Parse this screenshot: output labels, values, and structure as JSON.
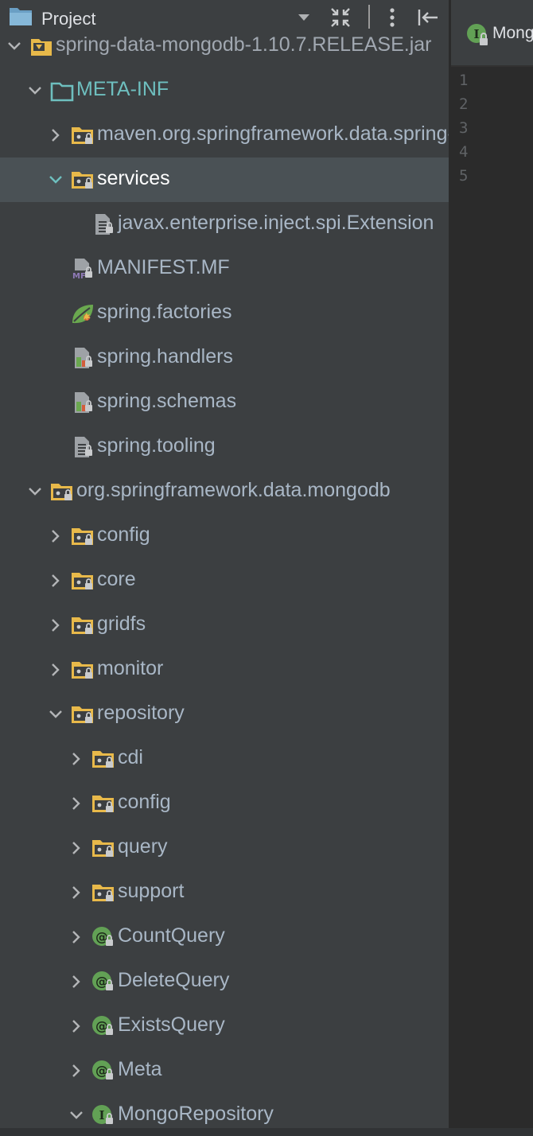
{
  "panel": {
    "title": "Project"
  },
  "tree": [
    {
      "label": "spring-data-mongodb-1.10.7.RELEASE.jar",
      "depth": 0,
      "expanded": true,
      "icon": "jar-icon",
      "style": "muted"
    },
    {
      "label": "META-INF",
      "depth": 1,
      "expanded": true,
      "icon": "meta-folder-icon",
      "style": "meta"
    },
    {
      "label": "maven.org.springframework.data.spring-data-mongodb",
      "depth": 2,
      "expanded": false,
      "icon": "package-folder-icon",
      "style": "normal"
    },
    {
      "label": "services",
      "depth": 2,
      "expanded": true,
      "icon": "package-folder-icon",
      "style": "bright",
      "selected": true
    },
    {
      "label": "javax.enterprise.inject.spi.Extension",
      "depth": 3,
      "icon": "text-file-icon",
      "style": "normal"
    },
    {
      "label": "MANIFEST.MF",
      "depth": 2,
      "icon": "manifest-file-icon",
      "style": "normal"
    },
    {
      "label": "spring.factories",
      "depth": 2,
      "icon": "spring-leaf-icon",
      "style": "normal"
    },
    {
      "label": "spring.handlers",
      "depth": 2,
      "icon": "spring-config-icon",
      "style": "normal"
    },
    {
      "label": "spring.schemas",
      "depth": 2,
      "icon": "spring-config-icon",
      "style": "normal"
    },
    {
      "label": "spring.tooling",
      "depth": 2,
      "icon": "text-file-icon",
      "style": "normal"
    },
    {
      "label": "org.springframework.data.mongodb",
      "depth": 1,
      "expanded": true,
      "icon": "package-folder-icon",
      "style": "normal"
    },
    {
      "label": "config",
      "depth": 2,
      "expanded": false,
      "icon": "package-folder-icon",
      "style": "normal"
    },
    {
      "label": "core",
      "depth": 2,
      "expanded": false,
      "icon": "package-folder-icon",
      "style": "normal"
    },
    {
      "label": "gridfs",
      "depth": 2,
      "expanded": false,
      "icon": "package-folder-icon",
      "style": "normal"
    },
    {
      "label": "monitor",
      "depth": 2,
      "expanded": false,
      "icon": "package-folder-icon",
      "style": "normal"
    },
    {
      "label": "repository",
      "depth": 2,
      "expanded": true,
      "icon": "package-folder-icon",
      "style": "normal"
    },
    {
      "label": "cdi",
      "depth": 3,
      "expanded": false,
      "icon": "package-folder-icon",
      "style": "normal"
    },
    {
      "label": "config",
      "depth": 3,
      "expanded": false,
      "icon": "package-folder-icon",
      "style": "normal"
    },
    {
      "label": "query",
      "depth": 3,
      "expanded": false,
      "icon": "package-folder-icon",
      "style": "normal"
    },
    {
      "label": "support",
      "depth": 3,
      "expanded": false,
      "icon": "package-folder-icon",
      "style": "normal"
    },
    {
      "label": "CountQuery",
      "depth": 3,
      "expanded": false,
      "icon": "annotation-icon",
      "style": "normal"
    },
    {
      "label": "DeleteQuery",
      "depth": 3,
      "expanded": false,
      "icon": "annotation-icon",
      "style": "normal"
    },
    {
      "label": "ExistsQuery",
      "depth": 3,
      "expanded": false,
      "icon": "annotation-icon",
      "style": "normal"
    },
    {
      "label": "Meta",
      "depth": 3,
      "expanded": false,
      "icon": "annotation-icon",
      "style": "normal"
    },
    {
      "label": "MongoRepository",
      "depth": 3,
      "expanded": true,
      "icon": "interface-icon",
      "style": "normal"
    }
  ],
  "editor": {
    "tab_label": "MongoRepository",
    "tab_icon": "interface-icon",
    "line_numbers": [
      "1",
      "2",
      "3",
      "4",
      "5"
    ]
  },
  "colors": {
    "panel_bg": "#3c3f41",
    "editor_bg": "#2b2b2b",
    "selection": "#4a5155",
    "folder_yellow": "#e8b94a",
    "meta_folder": "#6ebfbf",
    "annotation_green": "#62a155",
    "text": "#a9b7c6"
  }
}
